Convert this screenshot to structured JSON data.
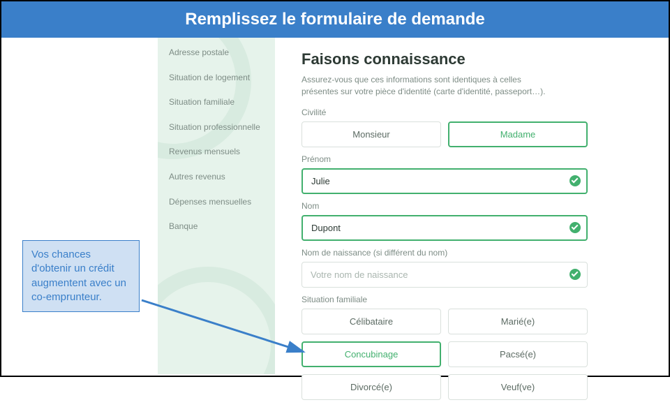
{
  "banner": {
    "title": "Remplissez le formulaire de demande"
  },
  "sidebar": {
    "items": [
      {
        "label": "Adresse postale"
      },
      {
        "label": "Situation de logement"
      },
      {
        "label": "Situation familiale"
      },
      {
        "label": "Situation professionnelle"
      },
      {
        "label": "Revenus mensuels"
      },
      {
        "label": "Autres revenus"
      },
      {
        "label": "Dépenses mensuelles"
      },
      {
        "label": "Banque"
      }
    ]
  },
  "form": {
    "heading": "Faisons connaissance",
    "subtext": "Assurez-vous que ces informations sont identiques à celles présentes sur votre pièce d'identité (carte d'identité, passeport…).",
    "civility": {
      "label": "Civilité",
      "options": [
        {
          "label": "Monsieur",
          "selected": false
        },
        {
          "label": "Madame",
          "selected": true
        }
      ]
    },
    "firstname": {
      "label": "Prénom",
      "value": "Julie",
      "valid": true
    },
    "lastname": {
      "label": "Nom",
      "value": "Dupont",
      "valid": true
    },
    "birthname": {
      "label": "Nom de naissance (si différent du nom)",
      "placeholder": "Votre nom de naissance",
      "value": "",
      "valid": true
    },
    "marital": {
      "label": "Situation familiale",
      "options": [
        {
          "label": "Célibataire",
          "selected": false
        },
        {
          "label": "Marié(e)",
          "selected": false
        },
        {
          "label": "Concubinage",
          "selected": true
        },
        {
          "label": "Pacsé(e)",
          "selected": false
        },
        {
          "label": "Divorcé(e)",
          "selected": false
        },
        {
          "label": "Veuf(ve)",
          "selected": false
        }
      ]
    }
  },
  "callout": {
    "text": "Vos chances d'obtenir un crédit augmentent avec un co-emprunteur."
  },
  "colors": {
    "accent": "#42b06e",
    "banner": "#3a7fc9",
    "calloutBg": "#cfe0f3"
  }
}
